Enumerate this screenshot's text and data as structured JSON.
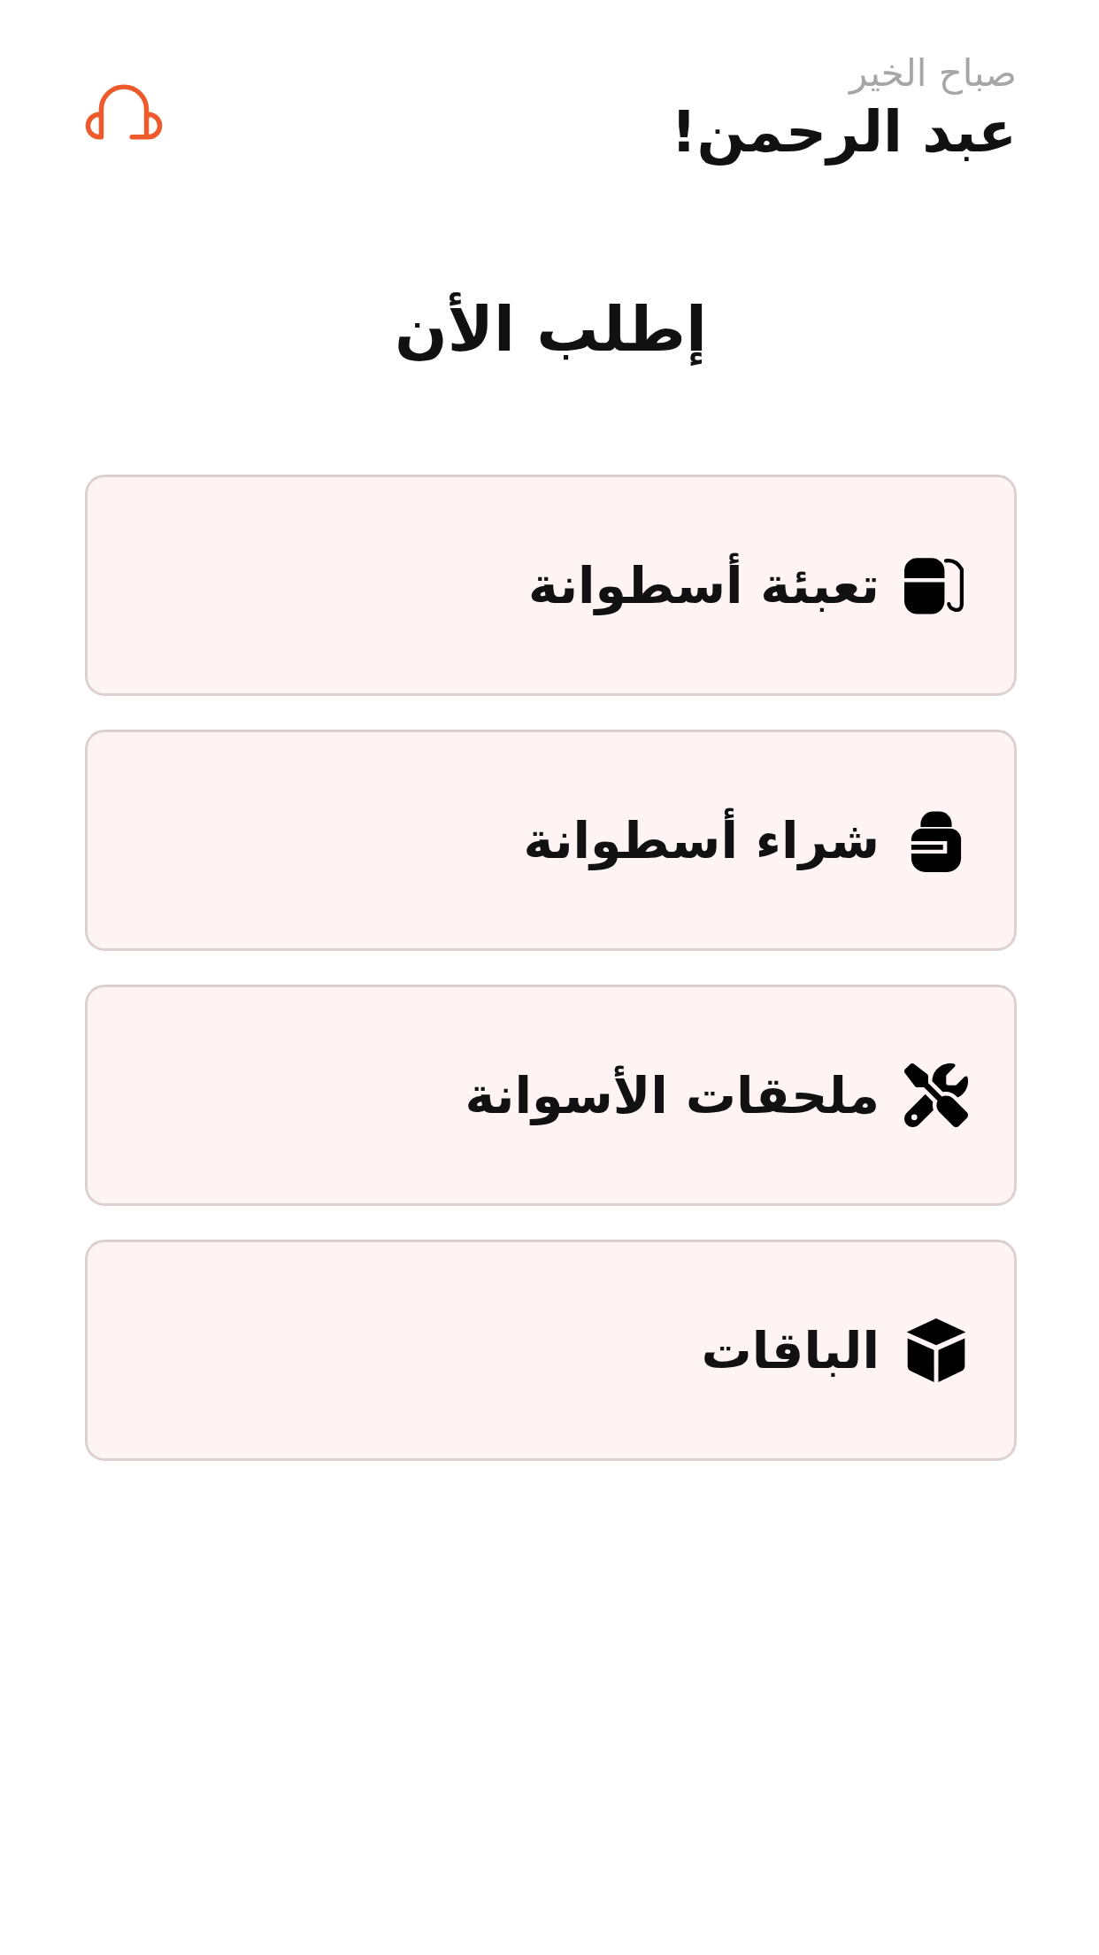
{
  "header": {
    "greeting": "صباح الخير",
    "user_name": "عبد الرحمن!"
  },
  "title": "إطلب الأن",
  "services": [
    {
      "kind": "refill",
      "label": "تعبئة أسطوانة"
    },
    {
      "kind": "buy",
      "label": "شراء أسطوانة"
    },
    {
      "kind": "accessories",
      "label": "ملحقات الأسوانة"
    },
    {
      "kind": "packages",
      "label": "الباقات"
    }
  ]
}
